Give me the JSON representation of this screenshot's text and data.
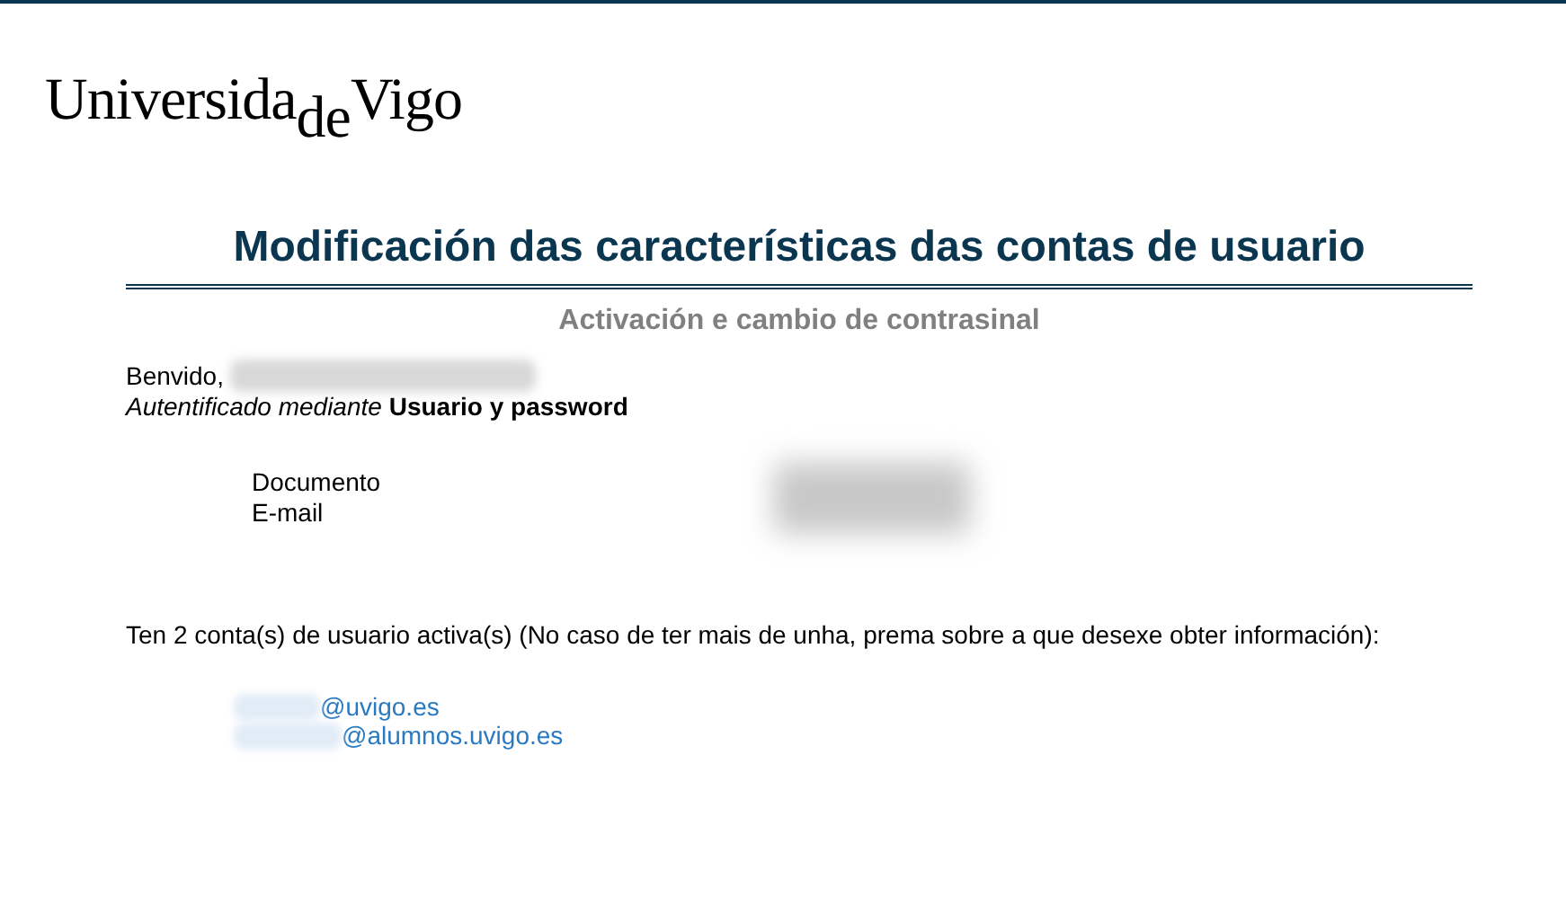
{
  "logo": {
    "text": "Universida$_{de}$Vigo"
  },
  "title": "Modificación das características das contas de usuario",
  "subtitle": "Activación e cambio de contrasinal",
  "welcome": {
    "greeting": "Benvido,",
    "auth": "*Autentificado mediante* **Usuario y password**"
  },
  "details": [
    {
      "label": "Documento"
    },
    {
      "label": "E-mail"
    }
  ],
  "accounts_intro": "Ten 2 conta(s) de usuario activa(s) (No caso de ter mais de unha, prema sobre a que desexe obter información):",
  "accounts": [
    {
      "domain": "@uvigo.es"
    },
    {
      "domain": "@alumnos.uvigo.es"
    }
  ]
}
